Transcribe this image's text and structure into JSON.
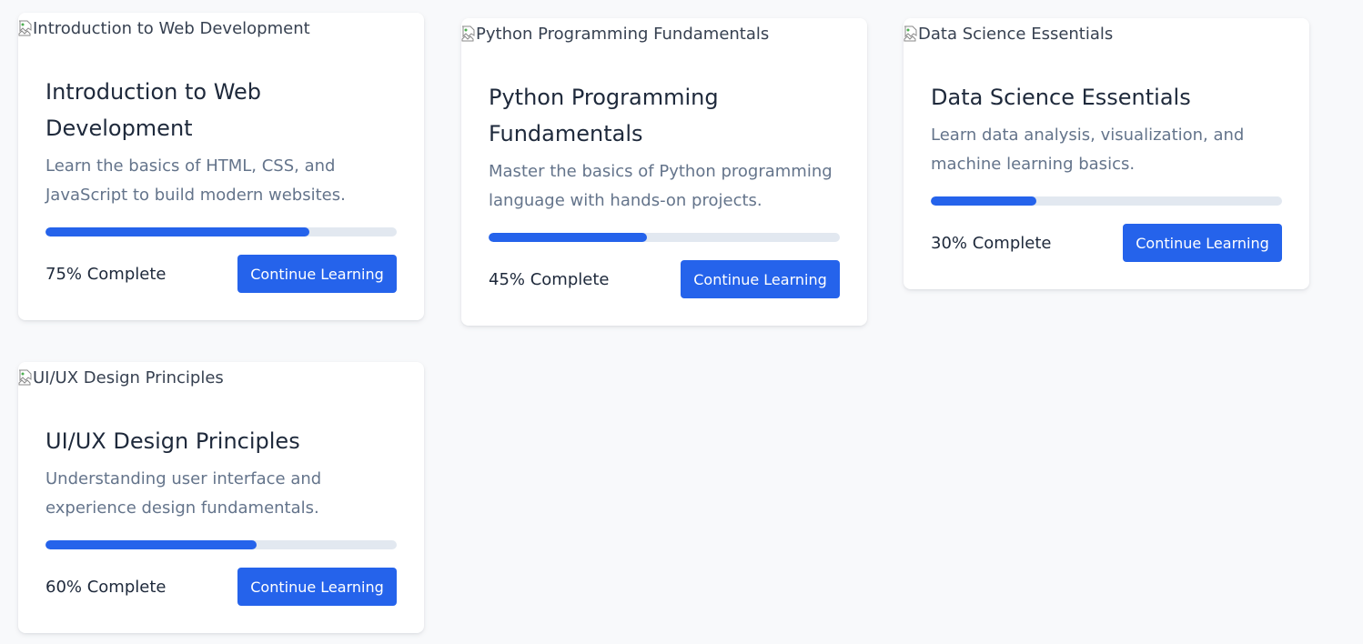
{
  "courses": [
    {
      "image_alt": "Introduction to Web Development",
      "title": "Introduction to Web Development",
      "description": "Learn the basics of HTML, CSS, and JavaScript to build modern websites.",
      "progress": 75,
      "progress_label": "75% Complete",
      "button_label": "Continue Learning"
    },
    {
      "image_alt": "Python Programming Fundamentals",
      "title": "Python Programming Fundamentals",
      "description": "Master the basics of Python programming language with hands-on projects.",
      "progress": 45,
      "progress_label": "45% Complete",
      "button_label": "Continue Learning"
    },
    {
      "image_alt": "Data Science Essentials",
      "title": "Data Science Essentials",
      "description": "Learn data analysis, visualization, and machine learning basics.",
      "progress": 30,
      "progress_label": "30% Complete",
      "button_label": "Continue Learning"
    },
    {
      "image_alt": "UI/UX Design Principles",
      "title": "UI/UX Design Principles",
      "description": "Understanding user interface and experience design fundamentals.",
      "progress": 60,
      "progress_label": "60% Complete",
      "button_label": "Continue Learning"
    }
  ],
  "colors": {
    "accent": "#2563eb",
    "track": "#e2e8f0",
    "background": "#f8f9fb"
  },
  "icons": {
    "broken_image": "broken-image-icon"
  }
}
